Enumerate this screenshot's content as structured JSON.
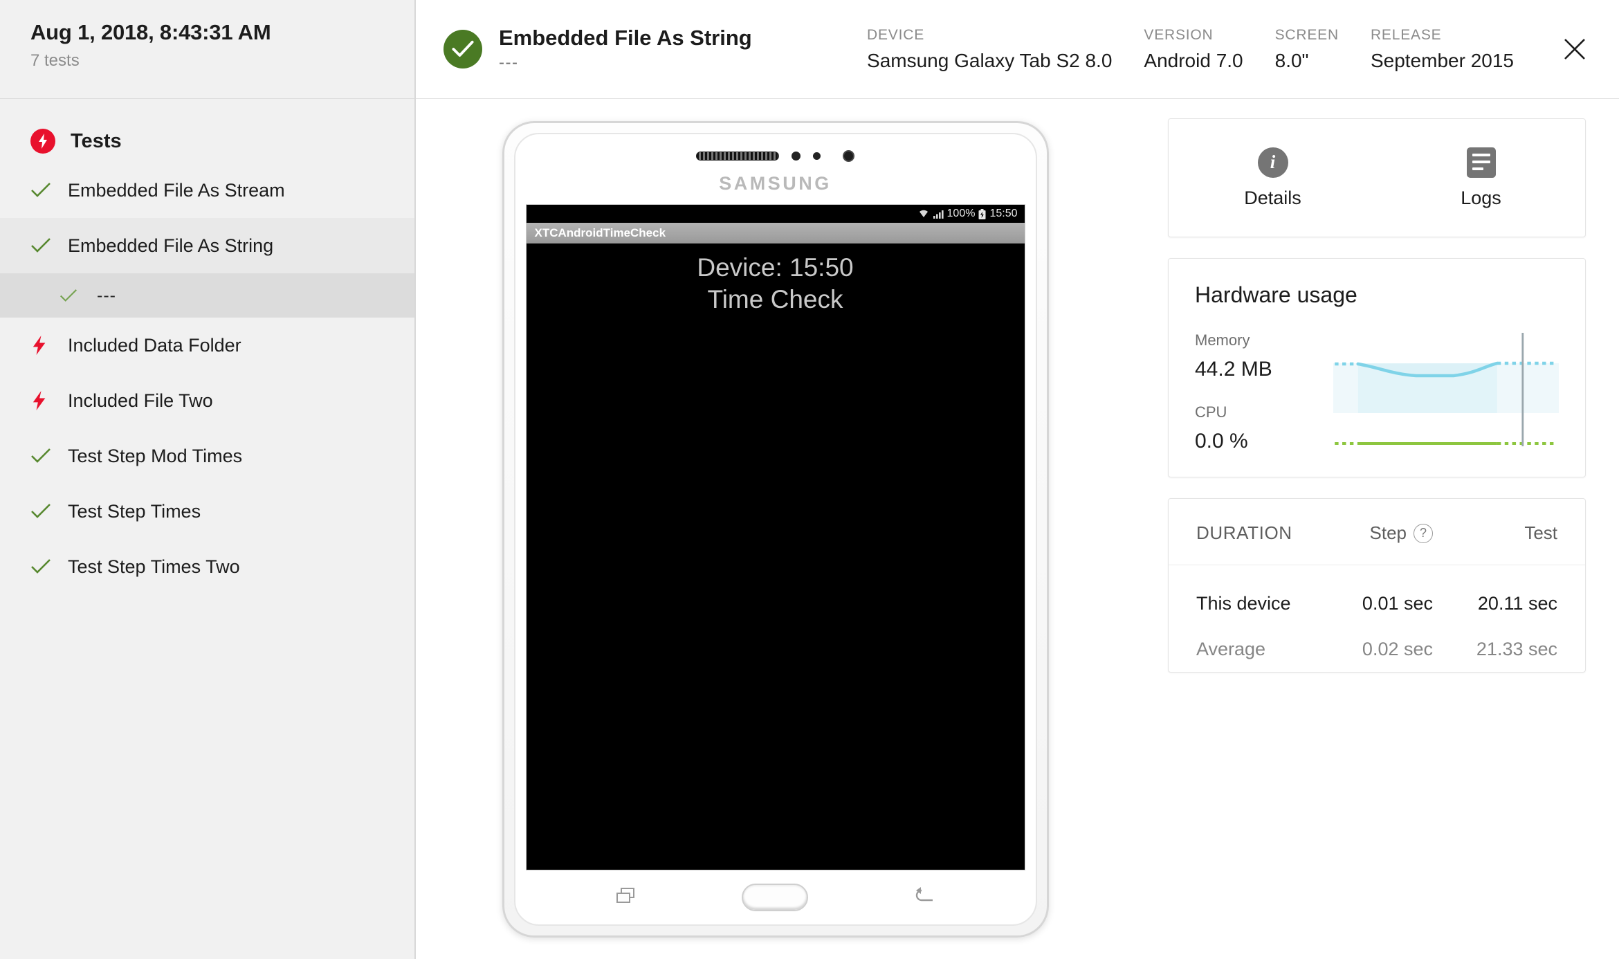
{
  "sidebar": {
    "run_date": "Aug 1, 2018, 8:43:31 AM",
    "test_count": "7 tests",
    "section_title": "Tests",
    "section_icon": "bolt-circle-icon",
    "items": [
      {
        "label": "Embedded File As Stream",
        "status": "passed",
        "icon": "check-icon",
        "selected": false,
        "sub": false
      },
      {
        "label": "Embedded File As String",
        "status": "passed",
        "icon": "check-icon",
        "selected": true,
        "sub": false
      },
      {
        "label": "---",
        "status": "passed",
        "icon": "check-icon",
        "selected": true,
        "sub": true
      },
      {
        "label": "Included Data Folder",
        "status": "failed",
        "icon": "bolt-icon",
        "selected": false,
        "sub": false
      },
      {
        "label": "Included File Two",
        "status": "failed",
        "icon": "bolt-icon",
        "selected": false,
        "sub": false
      },
      {
        "label": "Test Step Mod Times",
        "status": "passed",
        "icon": "check-icon",
        "selected": false,
        "sub": false
      },
      {
        "label": "Test Step Times",
        "status": "passed",
        "icon": "check-icon",
        "selected": false,
        "sub": false
      },
      {
        "label": "Test Step Times Two",
        "status": "passed",
        "icon": "check-icon",
        "selected": false,
        "sub": false
      }
    ]
  },
  "topbar": {
    "status_icon": "check-circle-icon",
    "status": "passed",
    "title": "Embedded File As String",
    "subtitle": "---",
    "meta": [
      {
        "label": "DEVICE",
        "value": "Samsung Galaxy Tab S2 8.0"
      },
      {
        "label": "VERSION",
        "value": "Android 7.0"
      },
      {
        "label": "SCREEN",
        "value": "8.0\""
      },
      {
        "label": "RELEASE",
        "value": "September 2015"
      }
    ],
    "close_icon": "close-icon"
  },
  "device": {
    "brand": "SAMSUNG",
    "status_bar": {
      "wifi_icon": "wifi-icon",
      "signal_icon": "signal-bars-icon",
      "battery_percent": "100%",
      "battery_icon": "battery-icon",
      "clock": "15:50"
    },
    "app_title": "XTCAndroidTimeCheck",
    "screen_lines": [
      "Device: 15:50",
      "Time Check"
    ],
    "nav": {
      "recents_icon": "recent-apps-icon",
      "home_icon": "home-button-icon",
      "back_icon": "back-arrow-icon"
    }
  },
  "tabs": [
    {
      "label": "Details",
      "icon": "info-icon"
    },
    {
      "label": "Logs",
      "icon": "logs-icon"
    }
  ],
  "hardware": {
    "title": "Hardware usage",
    "memory_label": "Memory",
    "memory_value": "44.2 MB",
    "cpu_label": "CPU",
    "cpu_value": "0.0 %",
    "memory_color": "#7fd3e8",
    "memory_fill": "#e2f4f9",
    "cpu_color": "#8dc63f",
    "marker_color": "#9aa7ad"
  },
  "duration": {
    "title": "DURATION",
    "col_step": "Step",
    "col_step_help_icon": "help-icon",
    "col_test": "Test",
    "rows": [
      {
        "name": "This device",
        "step": "0.01 sec",
        "test": "20.11 sec"
      },
      {
        "name": "Average",
        "step": "0.02 sec",
        "test": "21.33 sec"
      }
    ]
  },
  "chart_data": {
    "type": "line",
    "title": "Hardware usage",
    "series": [
      {
        "name": "Memory",
        "unit": "MB",
        "current": 44.2,
        "color": "#7fd3e8",
        "x": [
          0,
          12,
          25,
          38,
          50,
          62,
          75,
          88,
          100
        ],
        "values": [
          44.2,
          44.2,
          42.0,
          39.5,
          39.2,
          39.2,
          41.5,
          44.6,
          44.6
        ],
        "solid_range": [
          12,
          75
        ],
        "filled": true
      },
      {
        "name": "CPU",
        "unit": "%",
        "current": 0.0,
        "color": "#8dc63f",
        "x": [
          0,
          12,
          25,
          38,
          50,
          62,
          75,
          88,
          100
        ],
        "values": [
          0,
          0,
          0,
          0,
          0,
          0,
          0,
          0,
          0
        ],
        "solid_range": [
          12,
          75
        ],
        "filled": false
      }
    ],
    "marker_x": 88,
    "grid": false,
    "legend": "left-labels",
    "xlabel": "",
    "ylabel": ""
  }
}
